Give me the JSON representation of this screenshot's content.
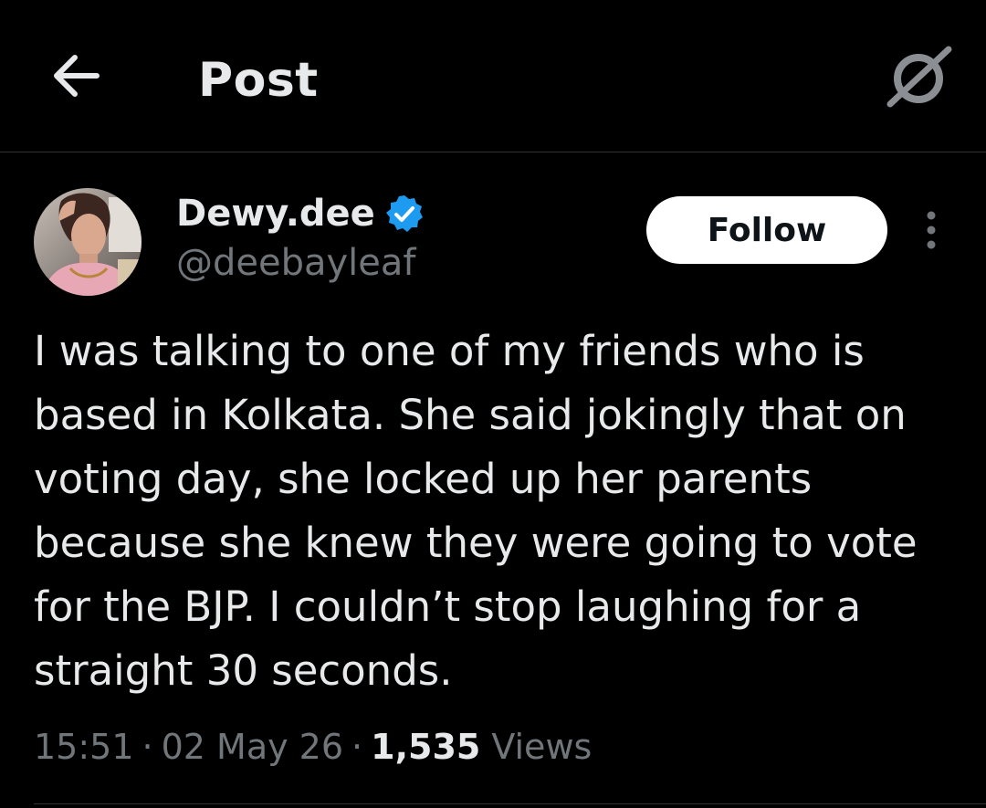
{
  "header": {
    "title": "Post",
    "back_icon": "arrow-left-icon",
    "grok_icon": "grok-icon"
  },
  "post": {
    "author": {
      "display_name": "Dewy.dee",
      "handle": "@deebayleaf",
      "verified": true,
      "verified_color": "#1d9bf0"
    },
    "follow_label": "Follow",
    "more_icon": "more-vertical-icon",
    "text": "I was talking to one of my friends who is based in Kolkata. She said jokingly that on voting day, she locked up her parents because she knew they were going to vote for the BJP. I couldn’t stop laughing for a straight 30 seconds.",
    "time": "15:51",
    "date": "02 May 26",
    "separator": "·",
    "views_count": "1,535",
    "views_label": "Views"
  },
  "colors": {
    "background": "#000000",
    "primary_text": "#e7e9ea",
    "secondary_text": "#71767b",
    "divider": "#2f3336",
    "follow_bg": "#ffffff",
    "follow_text": "#0f1419"
  }
}
